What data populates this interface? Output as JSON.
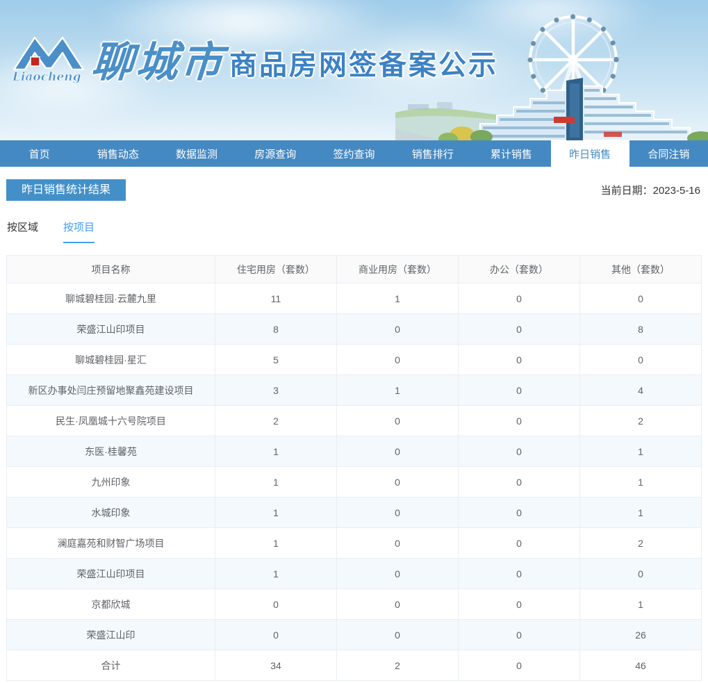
{
  "banner": {
    "logo_text": "Liaocheng",
    "site_name": "聊城市",
    "site_subtitle": "商品房网签备案公示"
  },
  "nav": {
    "items": [
      {
        "label": "首页",
        "active": false
      },
      {
        "label": "销售动态",
        "active": false
      },
      {
        "label": "数据监测",
        "active": false
      },
      {
        "label": "房源查询",
        "active": false
      },
      {
        "label": "签约查询",
        "active": false
      },
      {
        "label": "销售排行",
        "active": false
      },
      {
        "label": "累计销售",
        "active": false
      },
      {
        "label": "昨日销售",
        "active": true
      },
      {
        "label": "合同注销",
        "active": false
      }
    ]
  },
  "page": {
    "title": "昨日销售统计结果",
    "date_label": "当前日期：",
    "date_value": "2023-5-16"
  },
  "subtabs": [
    {
      "label": "按区域",
      "active": false
    },
    {
      "label": "按项目",
      "active": true
    }
  ],
  "table": {
    "columns": [
      "项目名称",
      "住宅用房（套数）",
      "商业用房（套数）",
      "办公（套数）",
      "其他（套数）"
    ],
    "rows": [
      [
        "聊城碧桂园·云麓九里",
        "11",
        "1",
        "0",
        "0"
      ],
      [
        "荣盛江山印项目",
        "8",
        "0",
        "0",
        "8"
      ],
      [
        "聊城碧桂园·星汇",
        "5",
        "0",
        "0",
        "0"
      ],
      [
        "新区办事处闫庄预留地聚鑫苑建设项目",
        "3",
        "1",
        "0",
        "4"
      ],
      [
        "民生·凤凰城十六号院项目",
        "2",
        "0",
        "0",
        "2"
      ],
      [
        "东医·桂馨苑",
        "1",
        "0",
        "0",
        "1"
      ],
      [
        "九州印象",
        "1",
        "0",
        "0",
        "1"
      ],
      [
        "水城印象",
        "1",
        "0",
        "0",
        "1"
      ],
      [
        "澜庭嘉苑和财智广场项目",
        "1",
        "0",
        "0",
        "2"
      ],
      [
        "荣盛江山印项目",
        "1",
        "0",
        "0",
        "0"
      ],
      [
        "京都欣城",
        "0",
        "0",
        "0",
        "1"
      ],
      [
        "荣盛江山印",
        "0",
        "0",
        "0",
        "26"
      ],
      [
        "合计",
        "34",
        "2",
        "0",
        "46"
      ]
    ]
  },
  "colors": {
    "nav_blue": "#4589c3",
    "badge_blue": "#4390c9",
    "active_tab_blue": "#409eff",
    "brand_blue": "#4a8fc9",
    "alt_row": "#f3f9fd",
    "table_border": "#e9eef3"
  }
}
